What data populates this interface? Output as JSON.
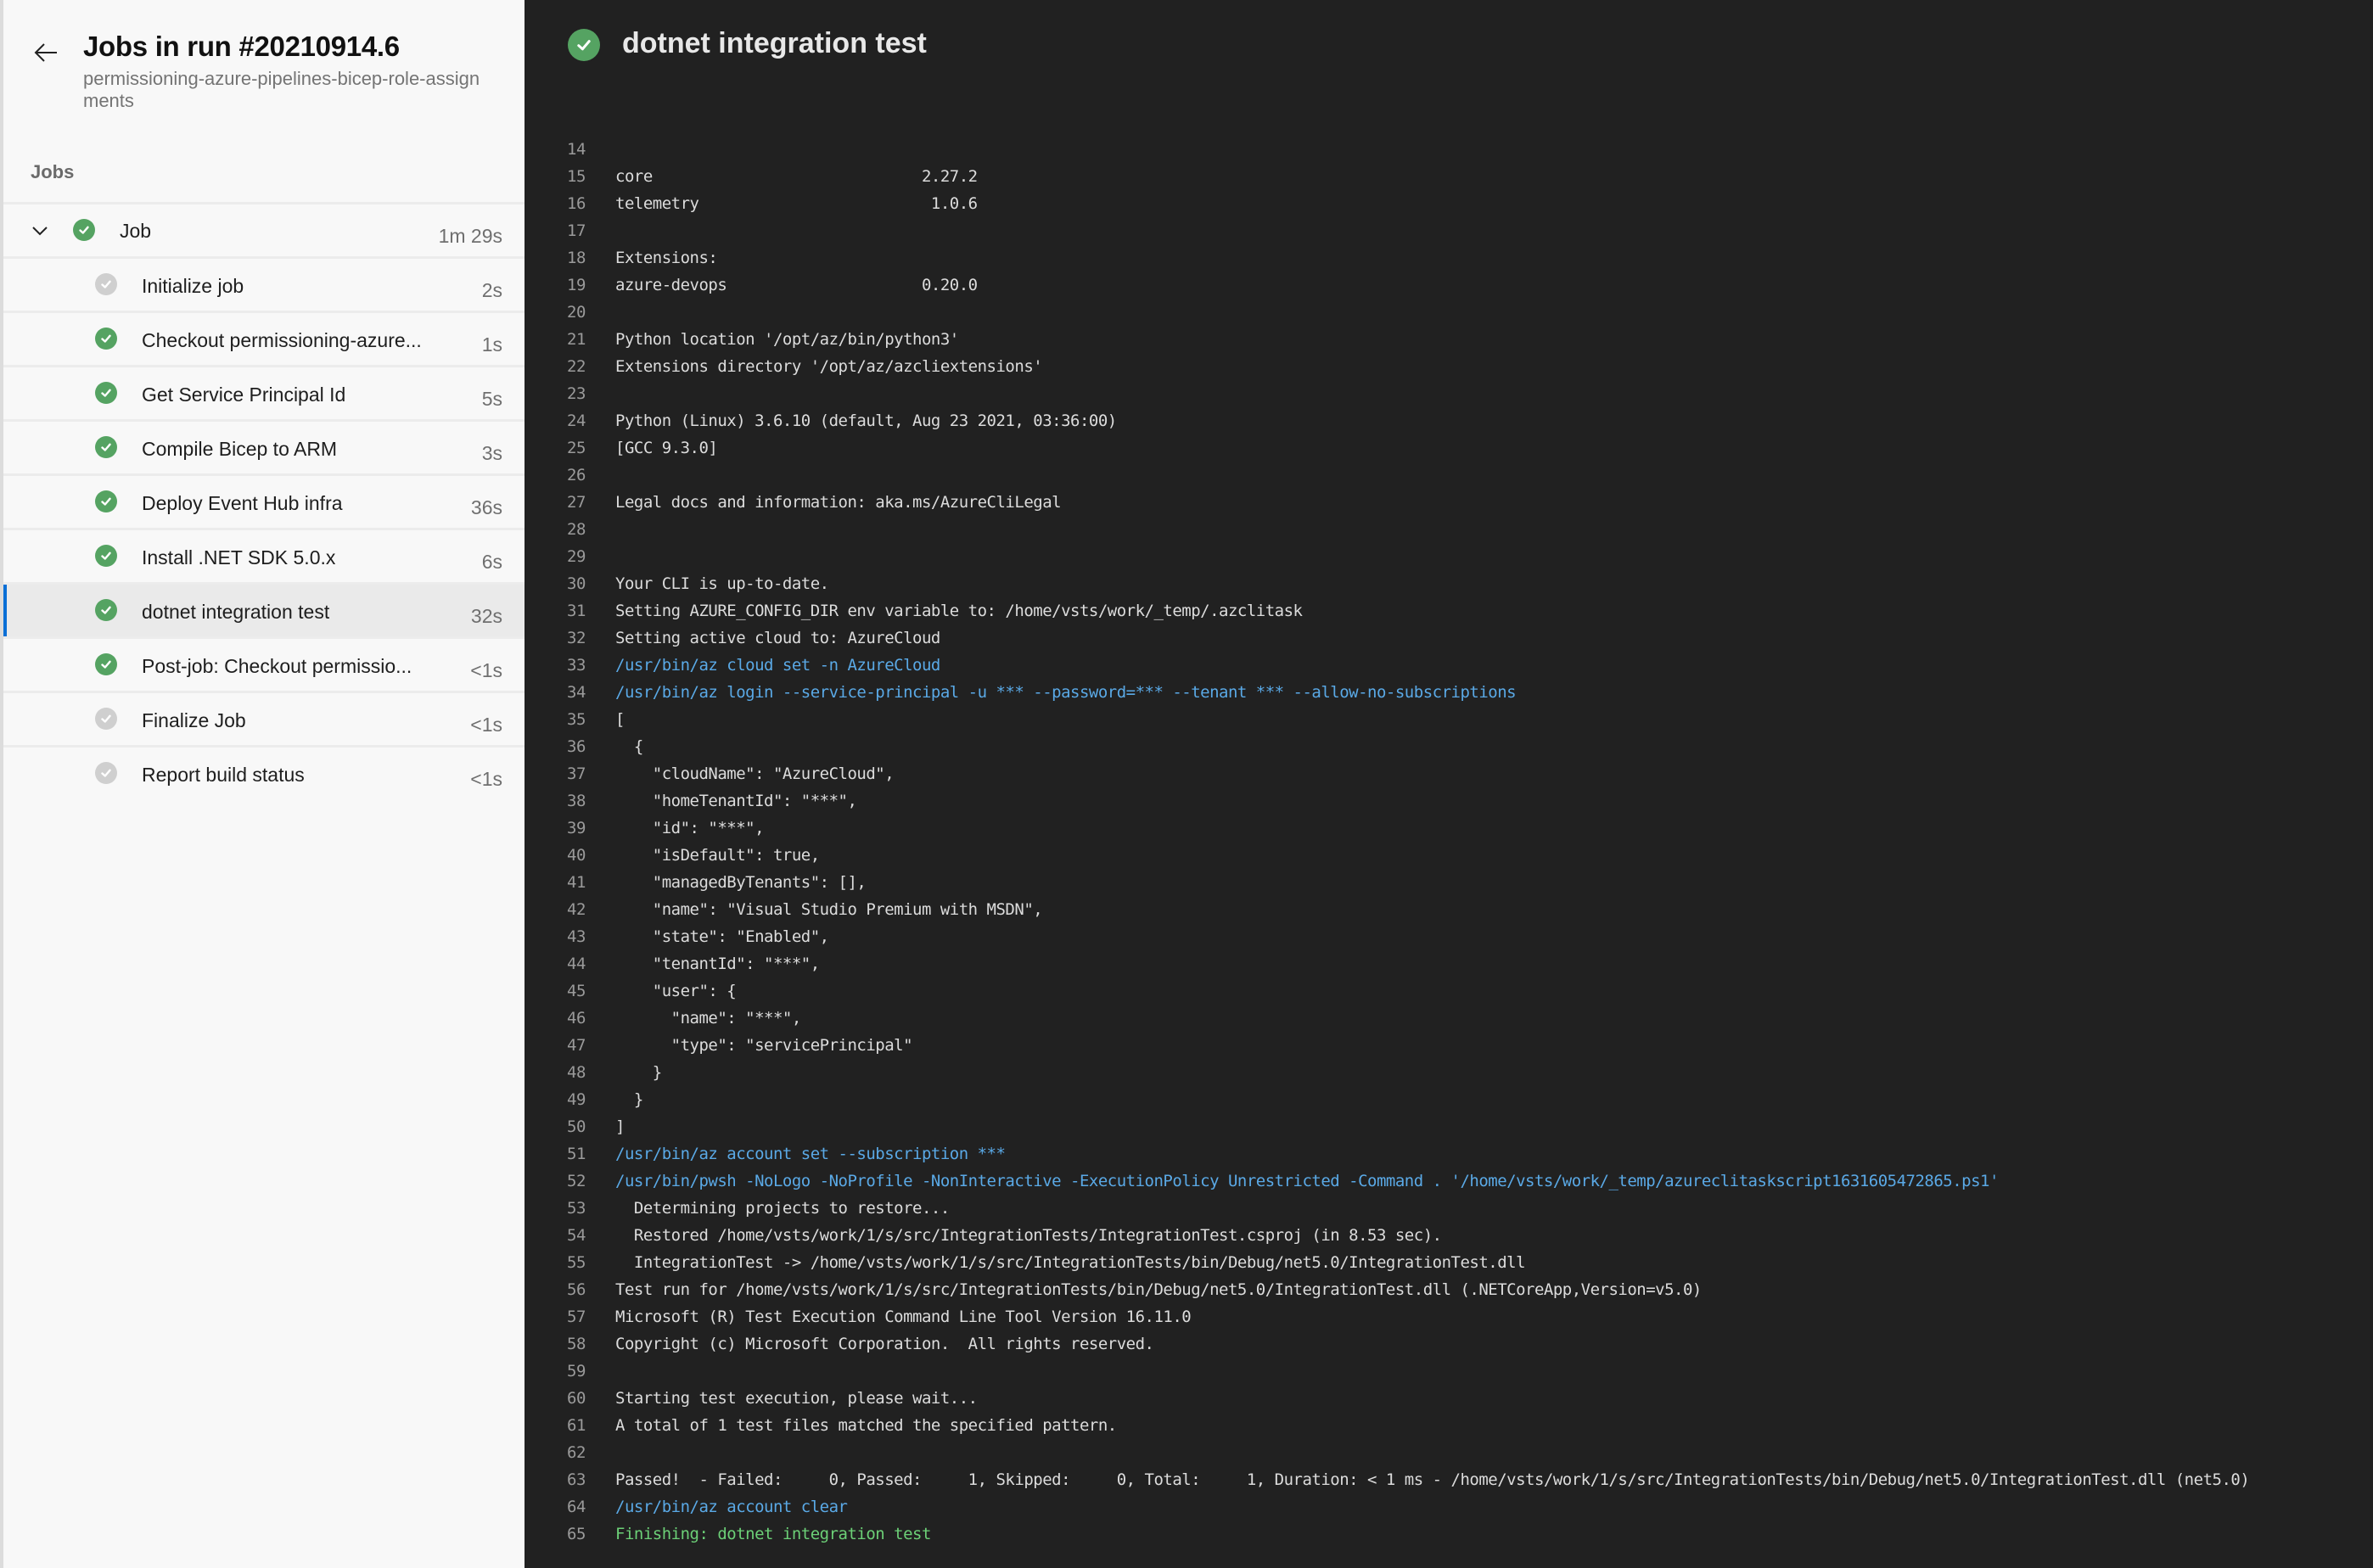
{
  "sidebar": {
    "back_icon": "arrow-left-icon",
    "title": "Jobs in run #20210914.6",
    "subtitle": "permissioning-azure-pipelines-bicep-role-assignments",
    "jobs_label": "Jobs",
    "job": {
      "label": "Job",
      "duration": "1m 29s",
      "status": "success",
      "expanded": true
    },
    "steps": [
      {
        "label": "Initialize job",
        "duration": "2s",
        "status": "skipped"
      },
      {
        "label": "Checkout permissioning-azure...",
        "duration": "1s",
        "status": "success"
      },
      {
        "label": "Get Service Principal Id",
        "duration": "5s",
        "status": "success"
      },
      {
        "label": "Compile Bicep to ARM",
        "duration": "3s",
        "status": "success"
      },
      {
        "label": "Deploy Event Hub infra",
        "duration": "36s",
        "status": "success"
      },
      {
        "label": "Install .NET SDK 5.0.x",
        "duration": "6s",
        "status": "success"
      },
      {
        "label": "dotnet integration test",
        "duration": "32s",
        "status": "success",
        "selected": true
      },
      {
        "label": "Post-job: Checkout permissio...",
        "duration": "<1s",
        "status": "success"
      },
      {
        "label": "Finalize Job",
        "duration": "<1s",
        "status": "skipped"
      },
      {
        "label": "Report build status",
        "duration": "<1s",
        "status": "skipped"
      }
    ]
  },
  "log": {
    "title": "dotnet integration test",
    "status": "success",
    "colors": {
      "background": "#212121",
      "text": "#dcdcdc",
      "line_number": "#9a9a9a",
      "command": "#5aa9e6",
      "section": "#6cd077",
      "success": "#55a362",
      "selected_accent": "#0a6fd6"
    },
    "lines": [
      {
        "n": "14",
        "t": "",
        "k": "text"
      },
      {
        "n": "15",
        "t": "core                             2.27.2",
        "k": "text"
      },
      {
        "n": "16",
        "t": "telemetry                         1.0.6",
        "k": "text"
      },
      {
        "n": "17",
        "t": "",
        "k": "text"
      },
      {
        "n": "18",
        "t": "Extensions:",
        "k": "text"
      },
      {
        "n": "19",
        "t": "azure-devops                     0.20.0",
        "k": "text"
      },
      {
        "n": "20",
        "t": "",
        "k": "text"
      },
      {
        "n": "21",
        "t": "Python location '/opt/az/bin/python3'",
        "k": "text"
      },
      {
        "n": "22",
        "t": "Extensions directory '/opt/az/azcliextensions'",
        "k": "text"
      },
      {
        "n": "23",
        "t": "",
        "k": "text"
      },
      {
        "n": "24",
        "t": "Python (Linux) 3.6.10 (default, Aug 23 2021, 03:36:00)",
        "k": "text"
      },
      {
        "n": "25",
        "t": "[GCC 9.3.0]",
        "k": "text"
      },
      {
        "n": "26",
        "t": "",
        "k": "text"
      },
      {
        "n": "27",
        "t": "Legal docs and information: aka.ms/AzureCliLegal",
        "k": "text"
      },
      {
        "n": "28",
        "t": "",
        "k": "text"
      },
      {
        "n": "29",
        "t": "",
        "k": "text"
      },
      {
        "n": "30",
        "t": "Your CLI is up-to-date.",
        "k": "text"
      },
      {
        "n": "31",
        "t": "Setting AZURE_CONFIG_DIR env variable to: /home/vsts/work/_temp/.azclitask",
        "k": "text"
      },
      {
        "n": "32",
        "t": "Setting active cloud to: AzureCloud",
        "k": "text"
      },
      {
        "n": "33",
        "t": "/usr/bin/az cloud set -n AzureCloud",
        "k": "cmd"
      },
      {
        "n": "34",
        "t": "/usr/bin/az login --service-principal -u *** --password=*** --tenant *** --allow-no-subscriptions",
        "k": "cmd"
      },
      {
        "n": "35",
        "t": "[",
        "k": "text"
      },
      {
        "n": "36",
        "t": "  {",
        "k": "text"
      },
      {
        "n": "37",
        "t": "    \"cloudName\": \"AzureCloud\",",
        "k": "text"
      },
      {
        "n": "38",
        "t": "    \"homeTenantId\": \"***\",",
        "k": "text"
      },
      {
        "n": "39",
        "t": "    \"id\": \"***\",",
        "k": "text"
      },
      {
        "n": "40",
        "t": "    \"isDefault\": true,",
        "k": "text"
      },
      {
        "n": "41",
        "t": "    \"managedByTenants\": [],",
        "k": "text"
      },
      {
        "n": "42",
        "t": "    \"name\": \"Visual Studio Premium with MSDN\",",
        "k": "text"
      },
      {
        "n": "43",
        "t": "    \"state\": \"Enabled\",",
        "k": "text"
      },
      {
        "n": "44",
        "t": "    \"tenantId\": \"***\",",
        "k": "text"
      },
      {
        "n": "45",
        "t": "    \"user\": {",
        "k": "text"
      },
      {
        "n": "46",
        "t": "      \"name\": \"***\",",
        "k": "text"
      },
      {
        "n": "47",
        "t": "      \"type\": \"servicePrincipal\"",
        "k": "text"
      },
      {
        "n": "48",
        "t": "    }",
        "k": "text"
      },
      {
        "n": "49",
        "t": "  }",
        "k": "text"
      },
      {
        "n": "50",
        "t": "]",
        "k": "text"
      },
      {
        "n": "51",
        "t": "/usr/bin/az account set --subscription ***",
        "k": "cmd"
      },
      {
        "n": "52",
        "t": "/usr/bin/pwsh -NoLogo -NoProfile -NonInteractive -ExecutionPolicy Unrestricted -Command . '/home/vsts/work/_temp/azureclitaskscript1631605472865.ps1'",
        "k": "cmd"
      },
      {
        "n": "53",
        "t": "  Determining projects to restore...",
        "k": "text"
      },
      {
        "n": "54",
        "t": "  Restored /home/vsts/work/1/s/src/IntegrationTests/IntegrationTest.csproj (in 8.53 sec).",
        "k": "text"
      },
      {
        "n": "55",
        "t": "  IntegrationTest -> /home/vsts/work/1/s/src/IntegrationTests/bin/Debug/net5.0/IntegrationTest.dll",
        "k": "text"
      },
      {
        "n": "56",
        "t": "Test run for /home/vsts/work/1/s/src/IntegrationTests/bin/Debug/net5.0/IntegrationTest.dll (.NETCoreApp,Version=v5.0)",
        "k": "text"
      },
      {
        "n": "57",
        "t": "Microsoft (R) Test Execution Command Line Tool Version 16.11.0",
        "k": "text"
      },
      {
        "n": "58",
        "t": "Copyright (c) Microsoft Corporation.  All rights reserved.",
        "k": "text"
      },
      {
        "n": "59",
        "t": "",
        "k": "text"
      },
      {
        "n": "60",
        "t": "Starting test execution, please wait...",
        "k": "text"
      },
      {
        "n": "61",
        "t": "A total of 1 test files matched the specified pattern.",
        "k": "text"
      },
      {
        "n": "62",
        "t": "",
        "k": "text"
      },
      {
        "n": "63",
        "t": "Passed!  - Failed:     0, Passed:     1, Skipped:     0, Total:     1, Duration: < 1 ms - /home/vsts/work/1/s/src/IntegrationTests/bin/Debug/net5.0/IntegrationTest.dll (net5.0)",
        "k": "text"
      },
      {
        "n": "64",
        "t": "/usr/bin/az account clear",
        "k": "cmd"
      },
      {
        "n": "65",
        "t": "Finishing: dotnet integration test",
        "k": "section"
      }
    ]
  }
}
